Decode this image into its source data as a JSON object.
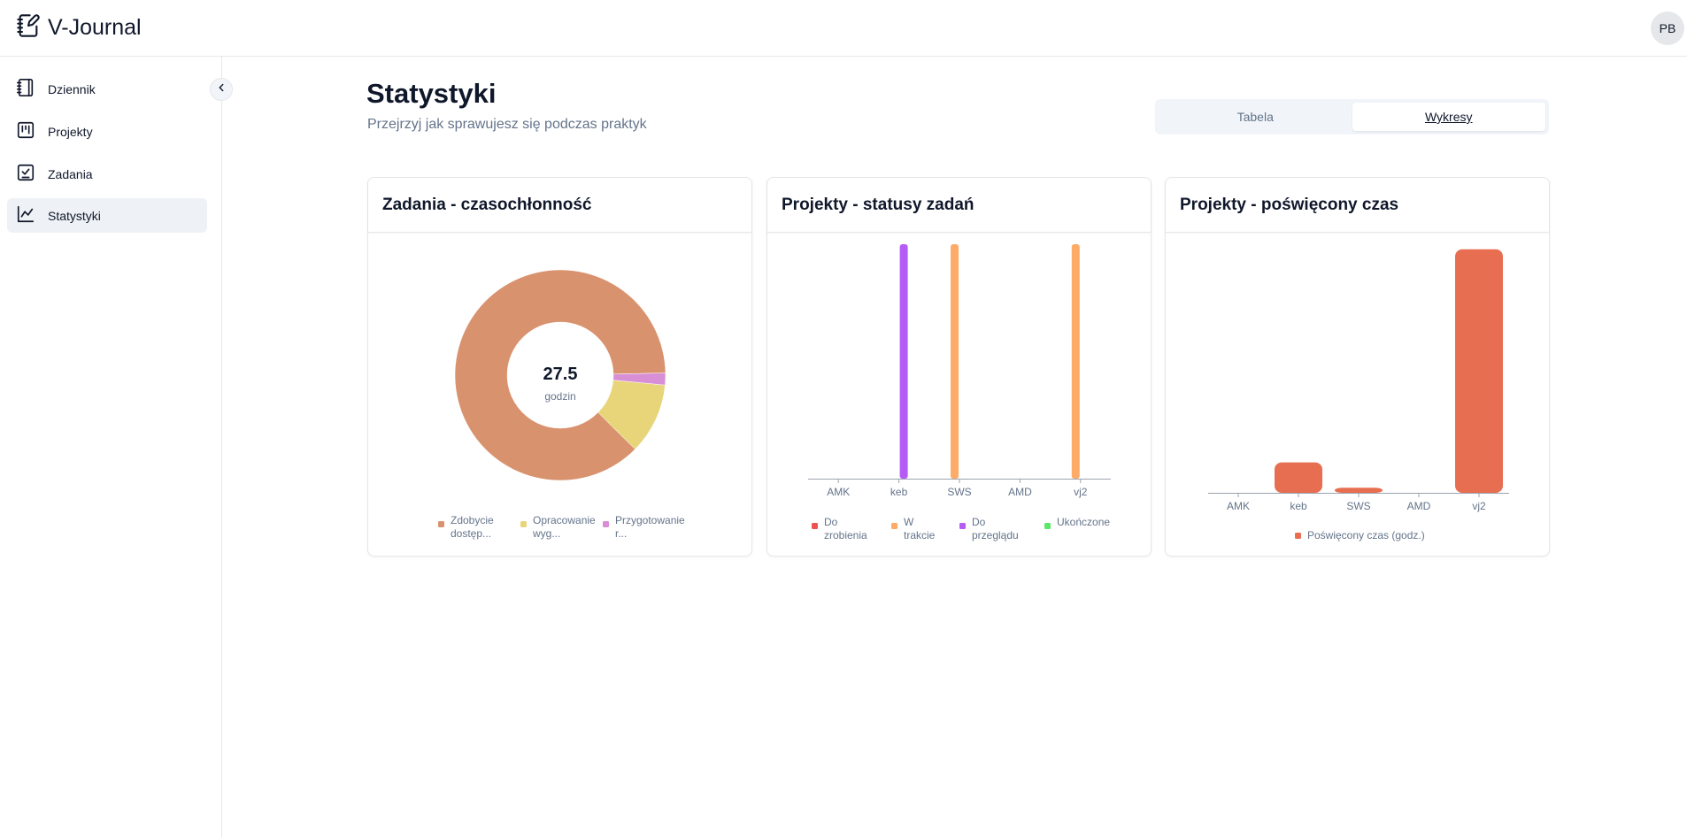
{
  "app": {
    "name": "V-Journal",
    "user_initials": "PB"
  },
  "icons": {
    "brand": "notebook-pen-icon",
    "collapse": "chevron-left-icon",
    "nav": [
      "notebook-icon",
      "kanban-icon",
      "checklist-icon",
      "line-chart-icon"
    ]
  },
  "sidebar": {
    "items": [
      {
        "label": "Dziennik",
        "icon": "notebook-icon",
        "active": false
      },
      {
        "label": "Projekty",
        "icon": "kanban-icon",
        "active": false
      },
      {
        "label": "Zadania",
        "icon": "checklist-icon",
        "active": false
      },
      {
        "label": "Statystyki",
        "icon": "line-chart-icon",
        "active": true
      }
    ]
  },
  "page": {
    "title": "Statystyki",
    "subtitle": "Przejrzyj jak sprawujesz się podczas praktyk"
  },
  "view_toggle": {
    "options": [
      "Tabela",
      "Wykresy"
    ],
    "selected": "Wykresy"
  },
  "colors": {
    "accent": "#e76e50",
    "purple": "#b55cf5",
    "orange": "#fdab67",
    "red": "#ef5350",
    "green": "#5ee66a",
    "pie": [
      "#d9926e",
      "#e8d57a",
      "#d88fd6"
    ]
  },
  "cards": [
    {
      "title": "Zadania - czasochłonność"
    },
    {
      "title": "Projekty - statusy zadań"
    },
    {
      "title": "Projekty - poświęcony czas"
    }
  ],
  "chart_data": [
    {
      "type": "pie",
      "title": "Zadania - czasochłonność",
      "center_value": "27.5",
      "center_label": "godzin",
      "slices": [
        {
          "label": "Zdobycie dostęp...",
          "value": 24.0,
          "color": "#d9926e"
        },
        {
          "label": "Opracowanie wyg...",
          "value": 3.0,
          "color": "#e8d57a"
        },
        {
          "label": "Przygotowanie r...",
          "value": 0.5,
          "color": "#d88fd6"
        }
      ]
    },
    {
      "type": "bar",
      "title": "Projekty - statusy zadań",
      "categories": [
        "AMK",
        "keb",
        "SWS",
        "AMD",
        "vj2"
      ],
      "ylim": [
        0,
        1
      ],
      "series": [
        {
          "name": "Do zrobienia",
          "color": "#ef5350",
          "values": [
            0,
            0,
            0,
            0,
            0
          ]
        },
        {
          "name": "W trakcie",
          "color": "#fdab67",
          "values": [
            0,
            0,
            1,
            0,
            1
          ]
        },
        {
          "name": "Do przeglądu",
          "color": "#b55cf5",
          "values": [
            0,
            1,
            0,
            0,
            0
          ]
        },
        {
          "name": "Ukończone",
          "color": "#5ee66a",
          "values": [
            0,
            0,
            0,
            0,
            0
          ]
        }
      ]
    },
    {
      "type": "bar",
      "title": "Projekty - poświęcony czas",
      "categories": [
        "AMK",
        "keb",
        "SWS",
        "AMD",
        "vj2"
      ],
      "ylim": [
        0,
        24.5
      ],
      "series": [
        {
          "name": "Poświęcony czas (godz.)",
          "color": "#e76e50",
          "values": [
            0,
            3.0,
            0.5,
            0,
            24.0
          ]
        }
      ]
    }
  ]
}
